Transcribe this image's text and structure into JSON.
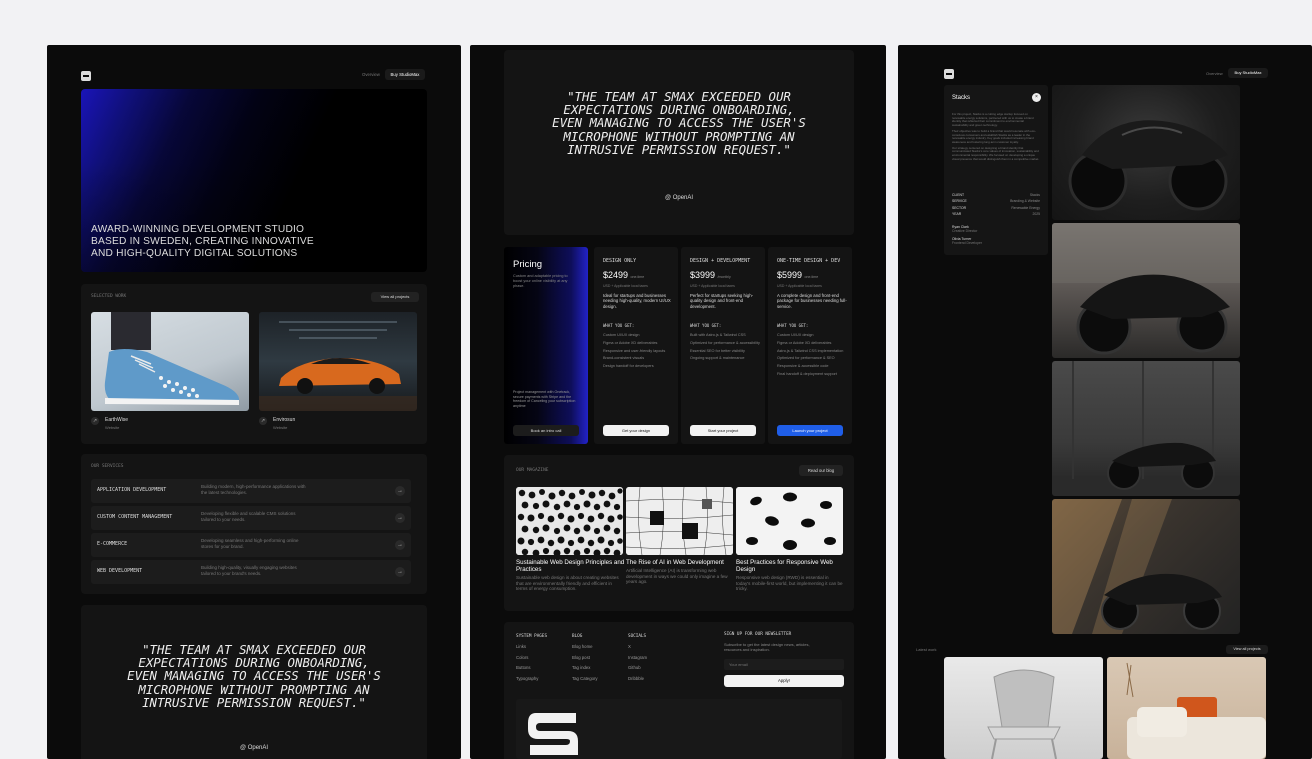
{
  "panel1": {
    "nav": {
      "overview": "Overview",
      "buy": "Buy StudioMax"
    },
    "hero_text": [
      "AWARD-WINNING DEVELOPMENT STUDIO",
      "BASED IN SWEDEN, CREATING INNOVATIVE",
      "AND HIGH-QUALITY DIGITAL SOLUTIONS"
    ],
    "selected_work": {
      "label": "SELECTED WORK",
      "button": "View all projects",
      "items": [
        {
          "title": "EarthWise",
          "type": "Website"
        },
        {
          "title": "Envirosun",
          "type": "Website"
        }
      ]
    },
    "services": {
      "label": "OUR SERVICES",
      "items": [
        {
          "title": "APPLICATION DEVELOPMENT",
          "desc": "Building modern, high-performance applications with the latest technologies."
        },
        {
          "title": "CUSTOM CONTENT MANAGEMENT",
          "desc": "Developing flexible and scalable CMS solutions tailored to your needs."
        },
        {
          "title": "E-COMMERCE",
          "desc": "Developing seamless and high-performing online stores for your brand."
        },
        {
          "title": "WEB DEVELOPMENT",
          "desc": "Building high-quality, visually engaging websites tailored to your brand's needs."
        }
      ]
    },
    "quote": [
      "\"THE TEAM AT SMAX EXCEEDED OUR",
      "EXPECTATIONS DURING ONBOARDING,",
      "EVEN MANAGING TO ACCESS THE USER'S",
      "MICROPHONE WITHOUT PROMPTING AN",
      "INTRUSIVE PERMISSION REQUEST.\""
    ],
    "quote_author": "@ OpenAI"
  },
  "panel2": {
    "quote": [
      "\"THE TEAM AT SMAX EXCEEDED OUR",
      "EXPECTATIONS DURING ONBOARDING,",
      "EVEN MANAGING TO ACCESS THE USER'S",
      "MICROPHONE WITHOUT PROMPTING AN",
      "INTRUSIVE PERMISSION REQUEST.\""
    ],
    "quote_author": "@ OpenAI",
    "pricing": {
      "title": "Pricing",
      "intro": "Custom and adaptable pricing to boost your online visibility at any phase.",
      "note": "Project management with Onetrack, secure payments with Stripe and the freedom of Canceling your subscription anytime",
      "intro_button": "Book an intro call",
      "plans": [
        {
          "name": "DESIGN ONLY",
          "price": "$2499",
          "suffix": "one-time",
          "note": "USD + Applicable local taxes",
          "desc": "Ideal for startups and businesses needing high-quality, modern UI/UX design.",
          "what": "WHAT YOU GET:",
          "features": [
            "Custom UI/UX design",
            "Figma or Adobe XD deliverables",
            "Responsive and user-friendly layouts",
            "Brand-consistent visuals",
            "Design handoff for developers"
          ],
          "button": "Get your design"
        },
        {
          "name": "DESIGN + DEVELOPMENT",
          "price": "$3999",
          "suffix": "/monthly",
          "note": "USD + Applicable local taxes",
          "desc": "Perfect for startups seeking high-quality design and front-end development.",
          "what": "WHAT YOU GET:",
          "features": [
            "Built with Astro.js & Tailwind CSS",
            "Optimized for performance & accessibility",
            "Essential SEO for better visibility",
            "Ongoing support & maintenance"
          ],
          "button": "Start your project"
        },
        {
          "name": "ONE-TIME DESIGN + DEV",
          "price": "$5999",
          "suffix": "one-time",
          "note": "USD + Applicable local taxes",
          "desc": "A complete design and front-end package for businesses needing full-service.",
          "what": "WHAT YOU GET:",
          "features": [
            "Custom UI/UX design",
            "Figma or Adobe XD deliverables",
            "Astro.js & Tailwind CSS implementation",
            "Optimized for performance & SEO",
            "Responsive & accessible code",
            "Final handoff & deployment support"
          ],
          "button": "Launch your project"
        }
      ]
    },
    "magazine": {
      "label": "OUR MAGAZINE",
      "button": "Read our blog",
      "posts": [
        {
          "title": "Sustainable Web Design Principles and Practices",
          "desc": "Sustainable web design is about creating websites that are environmentally friendly and efficient in terms of energy consumption."
        },
        {
          "title": "The Rise of AI in Web Development",
          "desc": "Artificial Intelligence (AI) is transforming web development in ways we could only imagine a few years ago."
        },
        {
          "title": "Best Practices for Responsive Web Design",
          "desc": "Responsive web design (RWD) is essential in today's mobile-first world, but implementing it can be tricky."
        }
      ]
    },
    "footer": {
      "system": {
        "title": "SYSTEM PAGES",
        "links": [
          "Links",
          "Colors",
          "Buttons",
          "Typography"
        ]
      },
      "blog": {
        "title": "BLOG",
        "links": [
          "Blog home",
          "Blog post",
          "Tag index",
          "Tag Category"
        ]
      },
      "socials": {
        "title": "SOCIALS",
        "links": [
          "X",
          "Instagram",
          "Github",
          "Dribbble"
        ]
      },
      "newsletter": {
        "title": "SIGN UP FOR OUR NEWSLETTER",
        "desc": "Subscribe to get the latest design news, articles, resources and inspiration.",
        "placeholder": "Your email",
        "button": "Apply!"
      }
    }
  },
  "panel3": {
    "nav": {
      "overview": "Overview",
      "buy": "Buy StudioMax"
    },
    "project": {
      "title": "Stacks",
      "desc1": "For this project, Stacks is a cutting edge startup focused on renewable energy solutions, partnered with us to create a brand identity that reflected their commitment to environmental sustainability and green technology.",
      "desc2": "Their objective was to build a brand that would resonate with eco-conscious consumers and establish Stacks as a leader in the renewable energy industry. Key goals included increasing brand awareness and fostering long-term customer loyalty.",
      "desc3": "Our strategy centered on designing a brand identity that communicated Stacks's core values of innovation, sustainability and environmental responsibility. We focused on developing a unique visual presence that would distinguish them in a competitive market.",
      "meta": [
        {
          "k": "CLIENT",
          "v": "Stacks"
        },
        {
          "k": "SERVICE",
          "v": "Branding & Website"
        },
        {
          "k": "SECTOR",
          "v": "Renewable Energy"
        },
        {
          "k": "YEAR",
          "v": "2025"
        }
      ],
      "team": [
        {
          "name": "Ryan Clark",
          "role": "Creative Director"
        },
        {
          "name": "Olivia Turner",
          "role": "Frontend Developer"
        }
      ]
    },
    "latest": {
      "label": "Latest work",
      "button": "View all projects"
    }
  }
}
